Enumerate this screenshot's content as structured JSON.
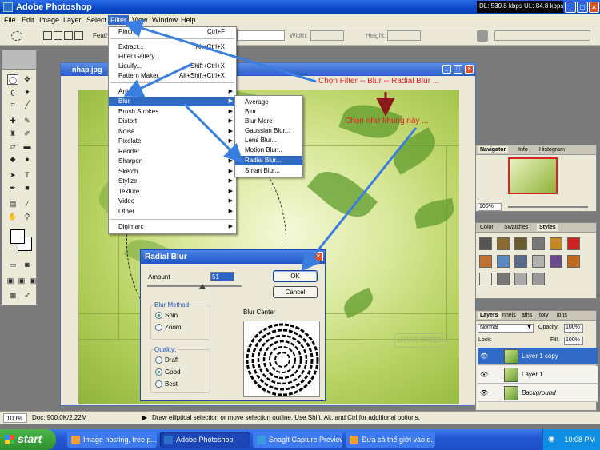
{
  "window": {
    "title": "Adobe Photoshop",
    "netstat": "DL: 530.8 kbps  UL: 84.8 kbps"
  },
  "menu": [
    "File",
    "Edit",
    "Image",
    "Layer",
    "Select",
    "Filter",
    "View",
    "Window",
    "Help"
  ],
  "options": {
    "feather_label": "Feath",
    "width_label": "Width:",
    "height_label": "Height:"
  },
  "document": {
    "title": "nhap.jpg",
    "logo_text": "LIVING GREEN"
  },
  "filter_menu": {
    "items": [
      {
        "label": "Pinch",
        "shortcut": "Ctrl+F"
      },
      {
        "label": "Extract...",
        "shortcut": "Alt+Ctrl+X"
      },
      {
        "label": "Filter Gallery...",
        "shortcut": ""
      },
      {
        "label": "Liquify...",
        "shortcut": "Shift+Ctrl+X"
      },
      {
        "label": "Pattern Maker...",
        "shortcut": "Alt+Shift+Ctrl+X"
      },
      {
        "label": "Artistic",
        "shortcut": ""
      },
      {
        "label": "Blur",
        "shortcut": ""
      },
      {
        "label": "Brush Strokes",
        "shortcut": ""
      },
      {
        "label": "Distort",
        "shortcut": ""
      },
      {
        "label": "Noise",
        "shortcut": ""
      },
      {
        "label": "Pixelate",
        "shortcut": ""
      },
      {
        "label": "Render",
        "shortcut": ""
      },
      {
        "label": "Sharpen",
        "shortcut": ""
      },
      {
        "label": "Sketch",
        "shortcut": ""
      },
      {
        "label": "Stylize",
        "shortcut": ""
      },
      {
        "label": "Texture",
        "shortcut": ""
      },
      {
        "label": "Video",
        "shortcut": ""
      },
      {
        "label": "Other",
        "shortcut": ""
      },
      {
        "label": "Digimarc",
        "shortcut": ""
      }
    ]
  },
  "blur_menu": {
    "items": [
      "Average",
      "Blur",
      "Blur More",
      "Gaussian Blur...",
      "Lens Blur...",
      "Motion Blur...",
      "Radial Blur...",
      "Smart Blur..."
    ]
  },
  "dialog": {
    "title": "Radial Blur",
    "amount_label": "Amount",
    "amount_value": "51",
    "ok": "OK",
    "cancel": "Cancel",
    "blur_method_label": "Blur Method:",
    "spin": "Spin",
    "zoom": "Zoom",
    "quality_label": "Quality:",
    "draft": "Draft",
    "good": "Good",
    "best": "Best",
    "blur_center_label": "Blur Center"
  },
  "navigator": {
    "tabs": [
      "Navigator",
      "Info",
      "Histogram"
    ],
    "zoom": "100%"
  },
  "styles": {
    "tabs": [
      "Color",
      "Swatches",
      "Styles"
    ]
  },
  "layers": {
    "tabs": [
      "Layers",
      "nnels",
      "aths",
      "tory",
      "ions"
    ],
    "blend_mode": "Normal",
    "opacity_label": "Opacity:",
    "opacity_value": "100%",
    "lock_label": "Lock:",
    "fill_label": "Fill:",
    "fill_value": "100%",
    "rows": [
      "Layer 1 copy",
      "Layer 1",
      "Background"
    ]
  },
  "status": {
    "zoom": "100%",
    "doc": "Doc: 900.0K/2.22M",
    "hint": "Draw elliptical selection or move selection outline.  Use Shift, Alt, and Ctrl for additional options."
  },
  "taskbar": {
    "start": "start",
    "tasks": [
      "Image hosting, free p...",
      "Adobe Photoshop",
      "SnagIt Capture Preview",
      "Đưa cả thế giới vào q..."
    ],
    "clock": "10:08 PM"
  },
  "annotations": {
    "line1": "Chọn Filter -- Blur -- Radial Blur ...",
    "line2": "Chọn như khung này ..."
  },
  "colors": {
    "xp_blue": "#0a48c8",
    "highlight": "#316ac5",
    "annotation": "#e02020",
    "arrow": "#3a7fe0"
  }
}
